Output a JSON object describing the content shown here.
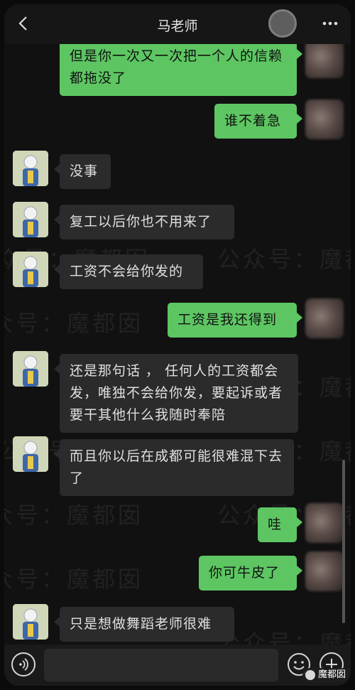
{
  "header": {
    "title": "马老师"
  },
  "messages": [
    {
      "side": "out",
      "text": "但是你一次又一次把一个人的信赖都拖没了"
    },
    {
      "side": "out",
      "text": "谁不着急"
    },
    {
      "side": "in",
      "text": "没事"
    },
    {
      "side": "in",
      "text": "复工以后你也不用来了"
    },
    {
      "side": "in",
      "text": "工资不会给你发的"
    },
    {
      "side": "out",
      "text": "工资是我还得到"
    },
    {
      "side": "in",
      "text": "还是那句话 ， 任何人的工资都会发，唯独不会给你发，要起诉或者要干其他什么我随时奉陪"
    },
    {
      "side": "in",
      "text": "而且你以后在成都可能很难混下去了"
    },
    {
      "side": "out",
      "text": "哇"
    },
    {
      "side": "out",
      "text": "你可牛皮了"
    },
    {
      "side": "in",
      "text": "只是想做舞蹈老师很难"
    }
  ],
  "watermarks": {
    "account": "公众号：魔都囡",
    "partial": "众号：魔都囡",
    "short": "魔都囡",
    "prefix": "众号："
  },
  "badge": {
    "label": "魔都囡"
  },
  "icons": {
    "back": "chevron-left-icon",
    "more": "more-dots-icon",
    "voice": "voice-icon",
    "emoji": "emoji-icon",
    "plus": "plus-icon"
  },
  "colors": {
    "outgoing_bubble": "#5dc662",
    "incoming_bubble": "#2b2b2b",
    "background": "#111111"
  }
}
